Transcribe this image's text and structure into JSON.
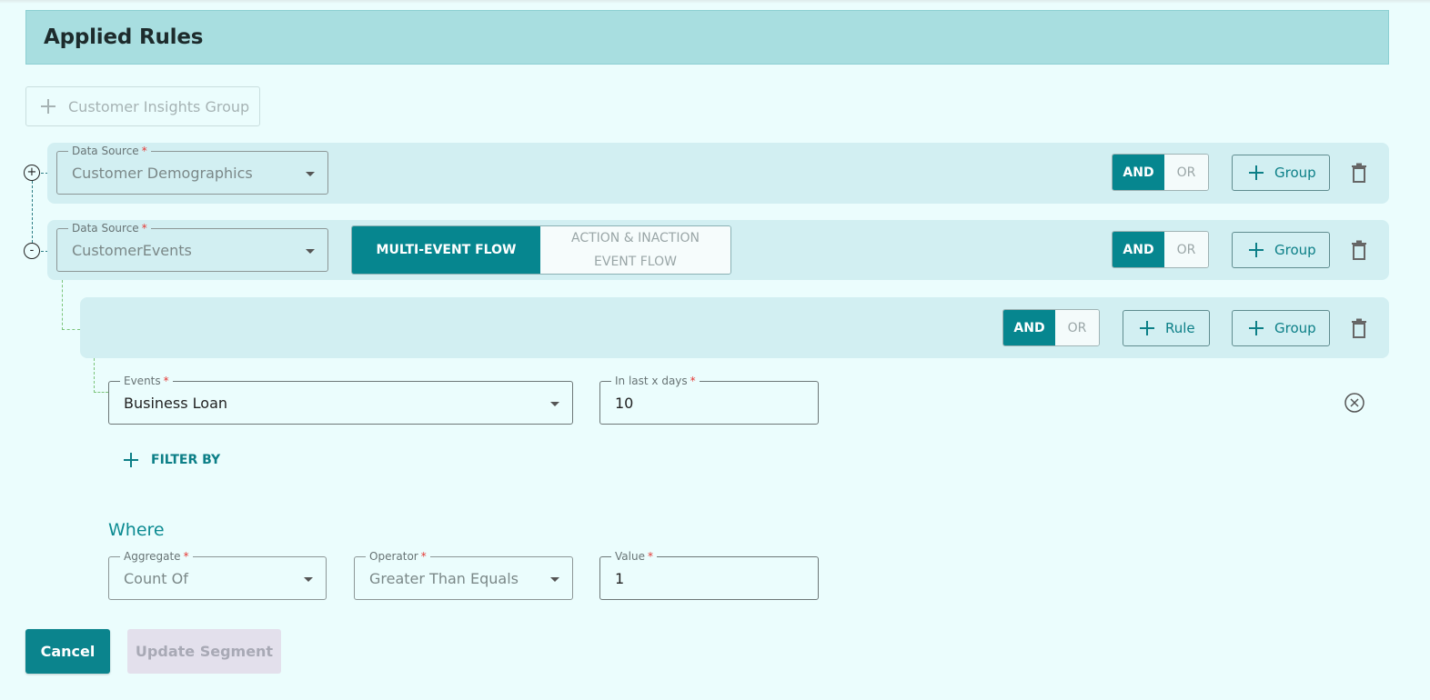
{
  "header": {
    "title": "Applied Rules"
  },
  "toolbar": {
    "add_group_label": "Customer Insights Group"
  },
  "group1": {
    "toggle_symbol": "+",
    "data_source": {
      "label": "Data Source",
      "value": "Customer Demographics"
    },
    "logic": {
      "and": "AND",
      "or": "OR",
      "selected": "AND"
    },
    "add_group_label": "Group"
  },
  "group2": {
    "toggle_symbol": "-",
    "data_source": {
      "label": "Data Source",
      "value": "CustomerEvents"
    },
    "flow_toggle": {
      "active": "MULTI-EVENT FLOW",
      "inactive_line1": "ACTION & INACTION",
      "inactive_line2": "EVENT FLOW"
    },
    "logic": {
      "and": "AND",
      "or": "OR",
      "selected": "AND"
    },
    "add_group_label": "Group"
  },
  "subgroup": {
    "logic": {
      "and": "AND",
      "or": "OR",
      "selected": "AND"
    },
    "add_rule_label": "Rule",
    "add_group_label": "Group"
  },
  "rule": {
    "events": {
      "label": "Events",
      "value": "Business Loan"
    },
    "days": {
      "label": "In last x days",
      "value": "10"
    },
    "filter_by_label": "FILTER BY"
  },
  "where": {
    "title": "Where",
    "aggregate": {
      "label": "Aggregate",
      "value": "Count Of"
    },
    "operator": {
      "label": "Operator",
      "value": "Greater Than Equals"
    },
    "value": {
      "label": "Value",
      "value": "1"
    }
  },
  "footer": {
    "cancel_label": "Cancel",
    "update_label": "Update Segment"
  },
  "colors": {
    "accent": "#06868f",
    "row_bg": "#d2eff2",
    "page_bg": "#ebfdfd",
    "header_bg": "#a8dee0"
  },
  "icons": {
    "add": "plus-icon",
    "delete": "trash-icon",
    "clear": "close-circle-icon",
    "dropdown": "chevron-down-icon"
  }
}
